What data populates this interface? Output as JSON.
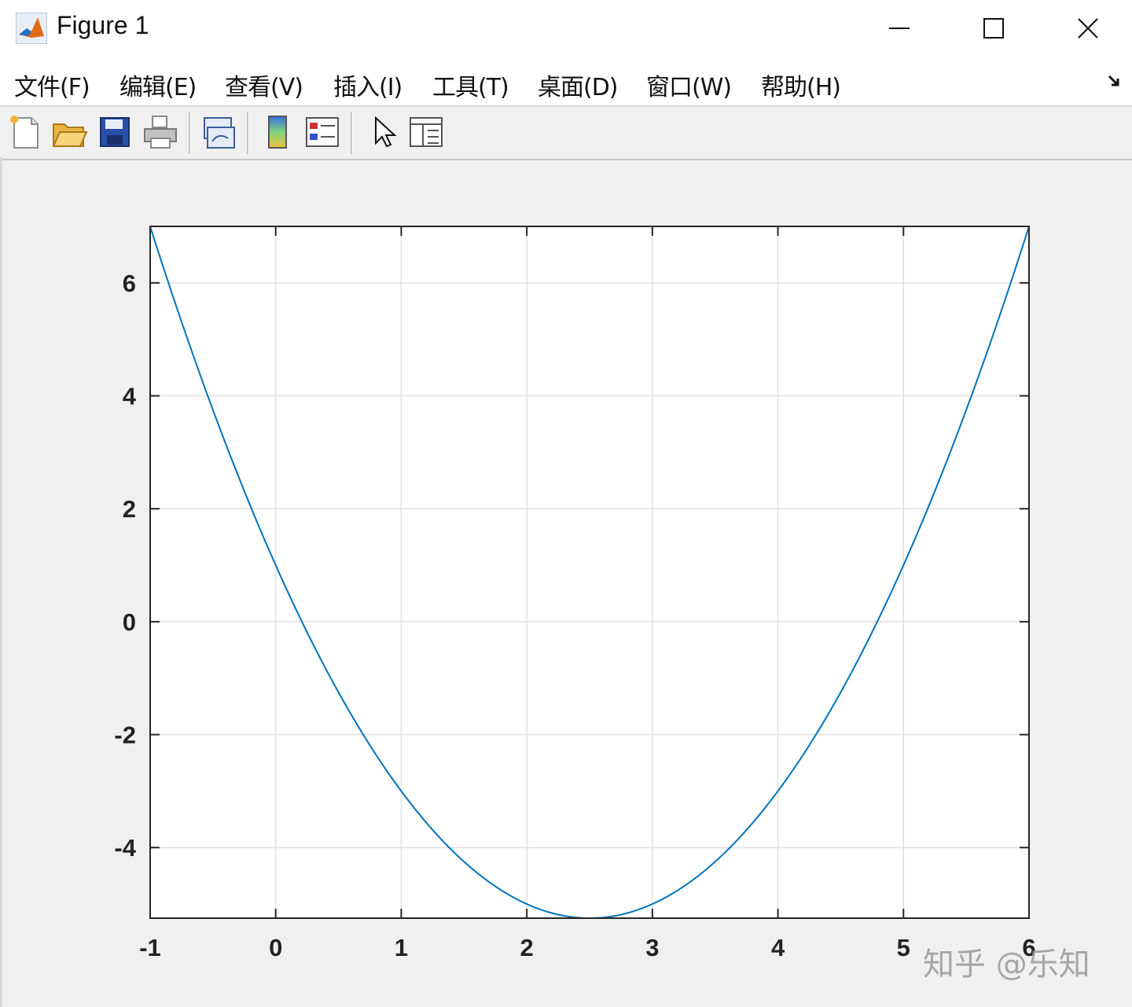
{
  "window": {
    "title": "Figure 1",
    "controls": [
      "minimize",
      "maximize",
      "close"
    ]
  },
  "menu": {
    "items": [
      {
        "label": "文件(F)"
      },
      {
        "label": "编辑(E)"
      },
      {
        "label": "查看(V)"
      },
      {
        "label": "插入(I)"
      },
      {
        "label": "工具(T)"
      },
      {
        "label": "桌面(D)"
      },
      {
        "label": "窗口(W)"
      },
      {
        "label": "帮助(H)"
      }
    ]
  },
  "toolbar": {
    "buttons": [
      "new-figure-icon",
      "open-file-icon",
      "save-icon",
      "print-icon",
      "link-plot-icon",
      "colorbar-icon",
      "legend-icon",
      "select-pointer-icon",
      "property-inspector-icon"
    ]
  },
  "chart_data": {
    "type": "line",
    "function_samples": "y = x^2 - 5x + 1",
    "x": [
      -1,
      -0.5,
      0,
      0.5,
      1,
      1.5,
      2,
      2.5,
      3,
      3.5,
      4,
      4.5,
      5,
      5.5,
      6
    ],
    "series": [
      {
        "values": [
          7,
          3.75,
          1,
          -1.25,
          -3,
          -4.25,
          -5,
          -5.25,
          -5,
          -4.25,
          -3,
          -1.25,
          1,
          3.75,
          7
        ],
        "color": "#0072BD"
      }
    ],
    "xlim": [
      -1,
      6
    ],
    "ylim": [
      -5.25,
      7
    ],
    "xticks": [
      "-1",
      "0",
      "1",
      "2",
      "3",
      "4",
      "5",
      "6"
    ],
    "yticks": [
      "-4",
      "-2",
      "0",
      "2",
      "4",
      "6"
    ],
    "grid": true,
    "title": "",
    "xlabel": "",
    "ylabel": ""
  },
  "watermark": {
    "text": "知乎 @乐知"
  }
}
